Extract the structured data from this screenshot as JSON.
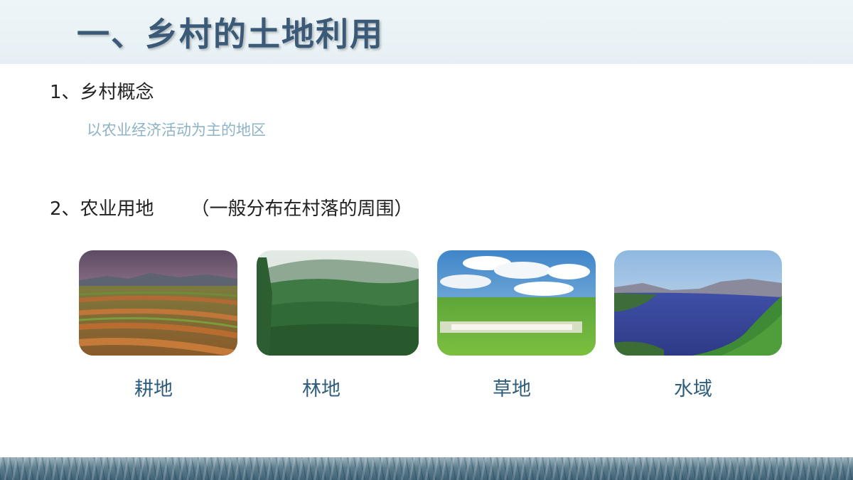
{
  "slide": {
    "title": "一、乡村的土地利用",
    "section1": {
      "heading": "1、乡村概念",
      "definition": "以农业经济活动为主的地区"
    },
    "section2": {
      "heading": "2、农业用地",
      "note": "（一般分布在村落的周围）"
    },
    "land_types": [
      {
        "label": "耕地",
        "image": "farmland-photo"
      },
      {
        "label": "林地",
        "image": "forest-photo"
      },
      {
        "label": "草地",
        "image": "grassland-photo"
      },
      {
        "label": "水域",
        "image": "water-photo"
      }
    ]
  },
  "colors": {
    "title": "#3b5a78",
    "title_band": "#eef5f8",
    "definition": "#8fb3c6",
    "caption": "#2f5d7c",
    "body_text": "#222222"
  }
}
